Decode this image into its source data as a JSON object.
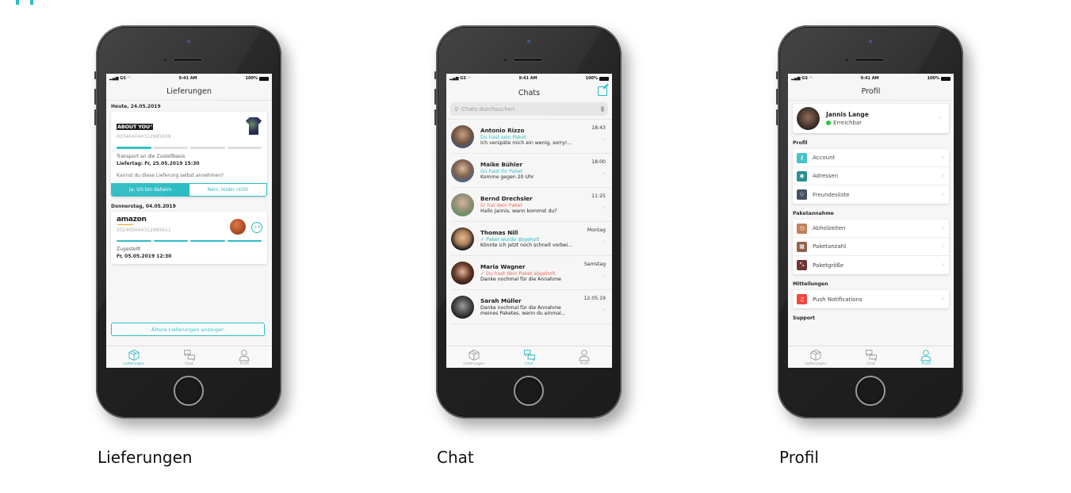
{
  "status_bar": {
    "carrier": "GS",
    "time": "9:41 AM",
    "battery": "100%"
  },
  "tabbar": {
    "tabs": [
      {
        "label": "Lieferungen",
        "icon": "package-icon"
      },
      {
        "label": "Chat",
        "icon": "chat-bubbles-icon"
      },
      {
        "label": "Profil",
        "icon": "person-icon"
      }
    ]
  },
  "screens": {
    "lieferungen": {
      "caption": "Lieferungen",
      "title": "Lieferungen",
      "groups": [
        {
          "date": "Heute, 24.05.2019",
          "delivery": {
            "brand": "ABOUT YOU°",
            "tracking": "003404044312985639",
            "progress_steps_done": 1,
            "progress_steps_total": 4,
            "status": "Transport an die Zustellbasis",
            "detail": "Liefertag: Fr, 25.05.2019 15:30",
            "question": "Kannst du diese Lieferung selbst annehmen?",
            "yes_label": "Ja, ich bin daheim",
            "no_label": "Nein, leider nicht"
          }
        },
        {
          "date": "Donnerstag, 04.05.2019",
          "delivery": {
            "brand": "amazon",
            "tracking": "002405044312985611",
            "extra_items": "+3",
            "progress_steps_done": 4,
            "progress_steps_total": 4,
            "status": "Zugestellt",
            "detail": "Fr, 05.05.2019 12:30"
          }
        }
      ],
      "older_button": "Ältere Lieferungen anzeigen"
    },
    "chat": {
      "caption": "Chat",
      "title": "Chats",
      "search_placeholder": "Chats durchsuchen",
      "chats": [
        {
          "name": "Antonio Rizzo",
          "time": "18:43",
          "sub": "Du hast sein Paket",
          "sub_tone": "teal",
          "message": "Ich verspäte mich ein wenig, sorry!..."
        },
        {
          "name": "Maike Bühler",
          "time": "18:00",
          "sub": "Du hast ihr Paket",
          "sub_tone": "teal",
          "message": "Komme gegen 20 Uhr"
        },
        {
          "name": "Bernd Drechsler",
          "time": "11:25",
          "sub": "Er hat dein Paket",
          "sub_tone": "red",
          "message": "Hallo Jannis, wann kommst du?"
        },
        {
          "name": "Thomas Nill",
          "time": "Montag",
          "sub": "✓ Paket wurde abgeholt",
          "sub_tone": "teal",
          "message": "Könnte ich jetzt noch schnell vorbei..."
        },
        {
          "name": "Maria Wagner",
          "time": "Samstag",
          "sub": "✓ Du hast dein Paket abgeholt",
          "sub_tone": "red",
          "message": "Danke nochmal für die Annahme"
        },
        {
          "name": "Sarah Müller",
          "time": "12.05.19",
          "sub": "",
          "sub_tone": "none",
          "message": "Danke nochmal für die Annahme",
          "message2": "meines Paketes, wenn du einmal..."
        }
      ]
    },
    "profil": {
      "caption": "Profil",
      "title": "Profil",
      "user": {
        "name": "Jannis Lange",
        "status": "Erreichbar"
      },
      "sections": [
        {
          "title": "Profil",
          "items": [
            {
              "label": "Account",
              "icon": "key-icon",
              "color": "#3cc0c6"
            },
            {
              "label": "Adressen",
              "icon": "location-pin-icon",
              "color": "#1f8a8c"
            },
            {
              "label": "Freundesliste",
              "icon": "friends-icon",
              "color": "#3e4a5c"
            }
          ]
        },
        {
          "title": "Paketannahme",
          "items": [
            {
              "label": "Abholzeiten",
              "icon": "clock-icon",
              "color": "#c07a52"
            },
            {
              "label": "Paketanzahl",
              "icon": "boxes-icon",
              "color": "#8c5a42"
            },
            {
              "label": "Paketgröße",
              "icon": "resize-icon",
              "color": "#6b2f2a"
            }
          ]
        },
        {
          "title": "Mitteilungen",
          "items": [
            {
              "label": "Push Notifications",
              "icon": "bell-icon",
              "color": "#f0483e"
            }
          ]
        },
        {
          "title": "Support",
          "items": []
        }
      ]
    }
  }
}
